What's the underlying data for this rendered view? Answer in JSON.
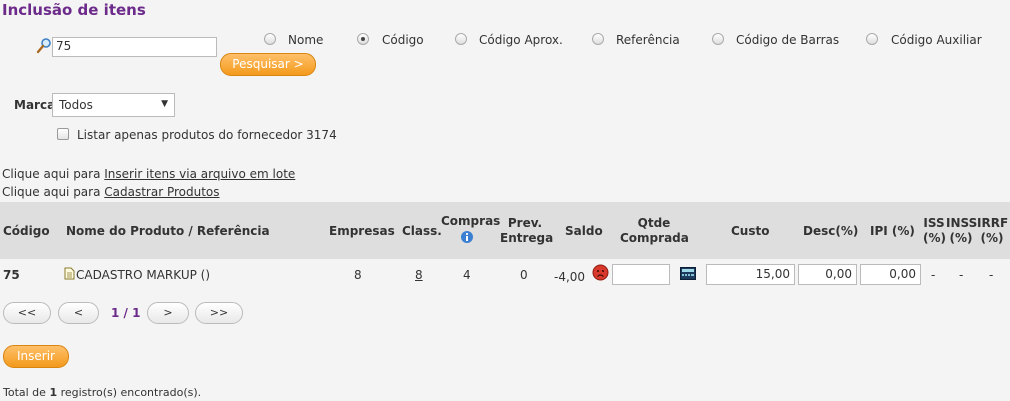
{
  "title": "Inclusão de itens",
  "search": {
    "value": "75",
    "button": "Pesquisar >"
  },
  "search_options": [
    {
      "label": "Nome",
      "checked": false
    },
    {
      "label": "Código",
      "checked": true
    },
    {
      "label": "Código Aprox.",
      "checked": false
    },
    {
      "label": "Referência",
      "checked": false
    },
    {
      "label": "Código de Barras",
      "checked": false
    },
    {
      "label": "Código Auxiliar",
      "checked": false
    }
  ],
  "brand": {
    "label": "Marca",
    "selected": "Todos"
  },
  "filter_checkbox": {
    "label": "Listar apenas produtos do fornecedor 3174",
    "checked": false
  },
  "links": {
    "line1_prefix": "Clique aqui para ",
    "line1_link": "Inserir itens via arquivo em lote",
    "line2_prefix": "Clique aqui para ",
    "line2_link": "Cadastrar Produtos"
  },
  "table": {
    "headers": {
      "codigo": "Código",
      "nome": "Nome do Produto / Referência",
      "empresas": "Empresas",
      "class": "Class.",
      "compras": "Compras",
      "prev_line1": "Prev.",
      "prev_line2": "Entrega",
      "saldo": "Saldo",
      "qtde_line1": "Qtde",
      "qtde_line2": "Comprada",
      "custo": "Custo",
      "desc": "Desc(%)",
      "ipi": "IPI (%)",
      "iss_line1": "ISS",
      "iss_line2": "(%)",
      "inss_line1": "INSS",
      "inss_line2": "(%)",
      "irrf_line1": "IRRF",
      "irrf_line2": "(%)"
    },
    "row": {
      "codigo": "75",
      "nome": "CADASTRO MARKUP ()",
      "empresas": "8",
      "class": "8",
      "compras": "4",
      "prev": "0",
      "saldo": "-4,00",
      "qtde": "",
      "custo": "15,00",
      "desc": "0,00",
      "ipi": "0,00",
      "iss": "-",
      "inss": "-",
      "irrf": "-"
    }
  },
  "pagination": {
    "first": "<<",
    "prev": "<",
    "page": "1 / 1",
    "next": ">",
    "last": ">>"
  },
  "insert_button": "Inserir",
  "footer": {
    "prefix": "Total de ",
    "count": "1",
    "suffix": " registro(s) encontrado(s)."
  },
  "colors": {
    "title": "#6c2a8a",
    "button": "#f39a1c",
    "header_bg": "#dedede"
  }
}
